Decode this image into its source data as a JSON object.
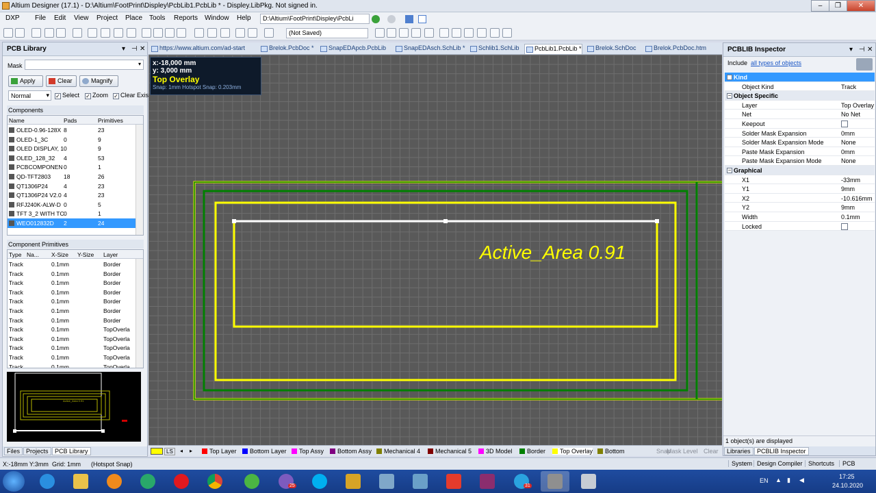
{
  "window": {
    "title": "Altium Designer (17.1) - D:\\Altium\\FootPrint\\Displey\\PcbLib1.PcbLib * - Disp­ley.LibPkg. Not signed in.",
    "minimize": "–",
    "maximize": "❐",
    "close": "✕"
  },
  "menu": {
    "items": [
      "DXP",
      "File",
      "Edit",
      "View",
      "Project",
      "Place",
      "Tools",
      "Reports",
      "Window",
      "Help"
    ],
    "path": "D:\\Altium\\FootPrint\\Disp­ley\\PcbLi"
  },
  "toolbar": {
    "save_state": "(Not Saved)"
  },
  "pcb_library": {
    "title": "PCB Library",
    "mask_label": "Mask",
    "mask_value": "",
    "buttons": {
      "apply": "Apply",
      "clear": "Clear",
      "magnify": "Magnify"
    },
    "mode": "Normal",
    "checks": {
      "select": "Select",
      "zoom": "Zoom",
      "clear_existing": "Clear Exis"
    },
    "components_title": "Components",
    "components_headers": [
      "Name",
      "Pads",
      "Primitives"
    ],
    "components": [
      {
        "name": "OLED-0.96-128X",
        "pads": "8",
        "prims": "23"
      },
      {
        "name": "OLED-1_3C",
        "pads": "0",
        "prims": "9"
      },
      {
        "name": "OLED DISPLAY, 1",
        "pads": "0",
        "prims": "9"
      },
      {
        "name": "OLED_128_32",
        "pads": "4",
        "prims": "53"
      },
      {
        "name": "PCBCOMPONEN",
        "pads": "0",
        "prims": "1"
      },
      {
        "name": "QD-TFT2803",
        "pads": "18",
        "prims": "26"
      },
      {
        "name": "QT1306P24",
        "pads": "4",
        "prims": "23"
      },
      {
        "name": "QT1306P24 V2.0",
        "pads": "4",
        "prims": "23"
      },
      {
        "name": "RFJ240K-ALW-D",
        "pads": "0",
        "prims": "5"
      },
      {
        "name": "TFT 3_2 WITH TC",
        "pads": "0",
        "prims": "1"
      },
      {
        "name": "WEO012832D",
        "pads": "2",
        "prims": "24"
      }
    ],
    "primitives_title": "Component Primitives",
    "primitives_headers": [
      "Type",
      "Na...",
      "X-Size",
      "Y-Size",
      "Layer"
    ],
    "primitives": [
      {
        "type": "Track",
        "size": "0.1mm",
        "layer": "Border"
      },
      {
        "type": "Track",
        "size": "0.1mm",
        "layer": "Border"
      },
      {
        "type": "Track",
        "size": "0.1mm",
        "layer": "Border"
      },
      {
        "type": "Track",
        "size": "0.1mm",
        "layer": "Border"
      },
      {
        "type": "Track",
        "size": "0.1mm",
        "layer": "Border"
      },
      {
        "type": "Track",
        "size": "0.1mm",
        "layer": "Border"
      },
      {
        "type": "Track",
        "size": "0.1mm",
        "layer": "Border"
      },
      {
        "type": "Track",
        "size": "0.1mm",
        "layer": "TopOverla"
      },
      {
        "type": "Track",
        "size": "0.1mm",
        "layer": "TopOverla"
      },
      {
        "type": "Track",
        "size": "0.1mm",
        "layer": "TopOverla"
      },
      {
        "type": "Track",
        "size": "0.1mm",
        "layer": "TopOverla"
      },
      {
        "type": "Track",
        "size": "0.1mm",
        "layer": "TopOverla"
      }
    ],
    "preview_text": "Active_Area 0.91",
    "bottom_tabs": [
      "Files",
      "Projects",
      "PCB Library"
    ]
  },
  "doc_tabs": [
    {
      "label": "https://www.altium.com/ad-start",
      "active": false
    },
    {
      "label": "Brelok.PcbDoc *",
      "active": false
    },
    {
      "label": "SnapEDApcb.PcbLib",
      "active": false
    },
    {
      "label": "SnapEDAsch.SchLib *",
      "active": false
    },
    {
      "label": "Schlib1.SchLib",
      "active": false
    },
    {
      "label": "PcbLib1.PcbLib *",
      "active": true
    },
    {
      "label": "Brelok.SchDoc",
      "active": false
    },
    {
      "label": "Brelok.PcbDoc.htm",
      "active": false
    }
  ],
  "canvas": {
    "coord_x": "x:-18,000  mm",
    "coord_y": "y:   3,000  mm",
    "layer": "Top Overlay",
    "snap": "Snap: 1mm Hotspot Snap: 0.203mm",
    "overlay_text": "Active_Area 0.91"
  },
  "layers": [
    {
      "label": "Top Layer",
      "color": "#ff0000"
    },
    {
      "label": "Bottom Layer",
      "color": "#0000ff"
    },
    {
      "label": "Top Assy",
      "color": "#ff00ff"
    },
    {
      "label": "Bottom Assy",
      "color": "#800080"
    },
    {
      "label": "Mechanical 4",
      "color": "#808000"
    },
    {
      "label": "Mechanical 5",
      "color": "#800000"
    },
    {
      "label": "3D Model",
      "color": "#ff00ff"
    },
    {
      "label": "Border",
      "color": "#008000"
    },
    {
      "label": "Top Overlay",
      "color": "#ffff00"
    },
    {
      "label": "Bottom",
      "color": "#808000"
    }
  ],
  "layer_controls": {
    "ls": "LS",
    "snap": "Snap",
    "mask_level": "Mask Level",
    "clear": "Clear"
  },
  "inspector": {
    "title": "PCBLIB Inspector",
    "include_prefix": "Include",
    "include_link": "all types of objects",
    "groups": {
      "kind": "Kind",
      "object_specific": "Object Specific",
      "graphical": "Graphical"
    },
    "kind_rows": [
      {
        "k": "Object Kind",
        "v": "Track"
      }
    ],
    "specific_rows": [
      {
        "k": "Layer",
        "v": "Top Overlay"
      },
      {
        "k": "Net",
        "v": "No Net"
      },
      {
        "k": "Keepout",
        "v": ""
      },
      {
        "k": "Solder Mask Expansion",
        "v": "0mm"
      },
      {
        "k": "Solder Mask Expansion Mode",
        "v": "None"
      },
      {
        "k": "Paste Mask Expansion",
        "v": "0mm"
      },
      {
        "k": "Paste Mask Expansion Mode",
        "v": "None"
      }
    ],
    "graphical_rows": [
      {
        "k": "X1",
        "v": "-33mm"
      },
      {
        "k": "Y1",
        "v": "9mm"
      },
      {
        "k": "X2",
        "v": "-10.616mm"
      },
      {
        "k": "Y2",
        "v": "9mm"
      },
      {
        "k": "Width",
        "v": "0.1mm"
      },
      {
        "k": "Locked",
        "v": ""
      }
    ],
    "status": "1 object(s) are displayed",
    "bottom_tabs": [
      "Libraries",
      "PCBLIB Inspector"
    ]
  },
  "statusbar": {
    "coords": "X:-18mm Y:3mm",
    "grid": "Grid: 1mm",
    "snap": "(Hotspot Snap)",
    "buttons": [
      "System",
      "Design Compiler",
      "Shortcuts",
      "PCB"
    ]
  },
  "taskbar": {
    "lang": "EN",
    "time": "17:25",
    "date": "24.10.2020",
    "badge_viber": "25",
    "badge_telegram": "31"
  },
  "colors": {
    "border_green": "#008000",
    "overlay_yellow": "#ffff00",
    "selected_white": "#ffffff",
    "accent_blue": "#3399ff"
  }
}
